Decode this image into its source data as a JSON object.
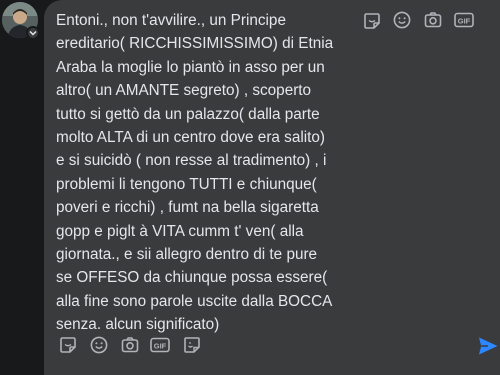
{
  "comment": {
    "text": "Entoni., non t'avvilire., un Principe\nereditario( RICCHISSIMISSIMO) di Etnia\nAraba la moglie lo piantò in asso per un\naltro( un AMANTE segreto) , scoperto\ntutto si gettò da un palazzo( dalla parte\nmolto ALTA di un centro dove era salito)\ne si suicidò ( non resse al tradimento) , i\nproblemi li tengono TUTTI e chiunque(\npoveri e ricchi) , fumt na bella sigaretta\ngopp e piglt à VITA cumm t' ven( alla\ngiornata., e sii allegro dentro di te pure\nse OFFESO da chiunque possa essere(\nalla fine sono parole uscite dalla BOCCA\nsenza. alcun significato)"
  },
  "toolbar_icons": [
    "sticker-icon",
    "emoji-icon",
    "camera-icon",
    "gif-icon",
    "avatar-sticker-icon"
  ],
  "gif_label": "GIF",
  "colors": {
    "background": "#18191a",
    "bubble": "#3a3b3c",
    "text": "#e4e6eb",
    "icon": "#b0b3b8",
    "send": "#2d88ff"
  }
}
